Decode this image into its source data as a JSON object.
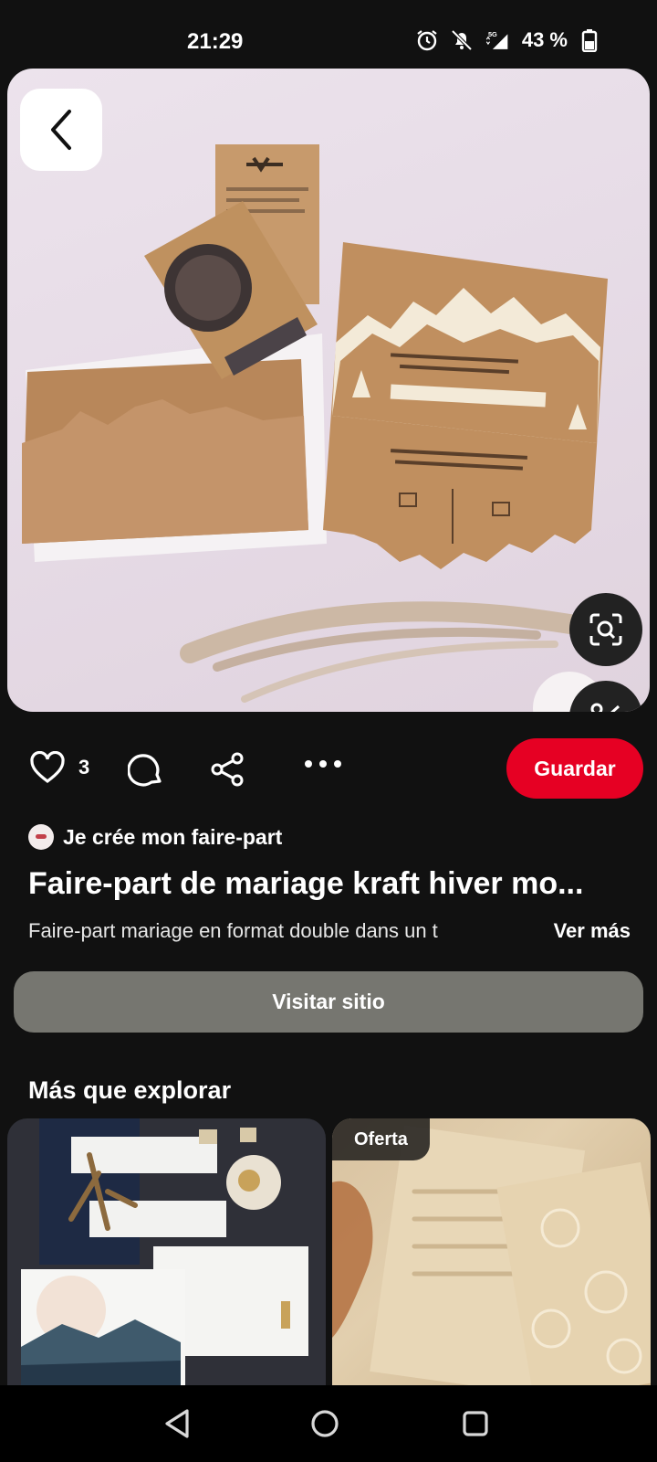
{
  "status_bar": {
    "time": "21:29",
    "network": "5G",
    "battery": "43 %",
    "icons": [
      "alarm-icon",
      "mute-notifications-icon",
      "signal-icon",
      "battery-icon"
    ]
  },
  "pin": {
    "like_count": "3",
    "save_label": "Guardar",
    "creator_name": "Je crée mon faire-part",
    "title": "Faire-part de mariage kraft hiver mo...",
    "description": "Faire-part mariage en format double dans un t",
    "see_more_label": "Ver más",
    "visit_label": "Visitar sitio"
  },
  "explore": {
    "title": "Más que explorar",
    "cards": [
      {
        "badge": ""
      },
      {
        "badge": "Oferta"
      }
    ]
  },
  "colors": {
    "background": "#111111",
    "save_button": "#e60023",
    "visit_button": "#767670"
  }
}
